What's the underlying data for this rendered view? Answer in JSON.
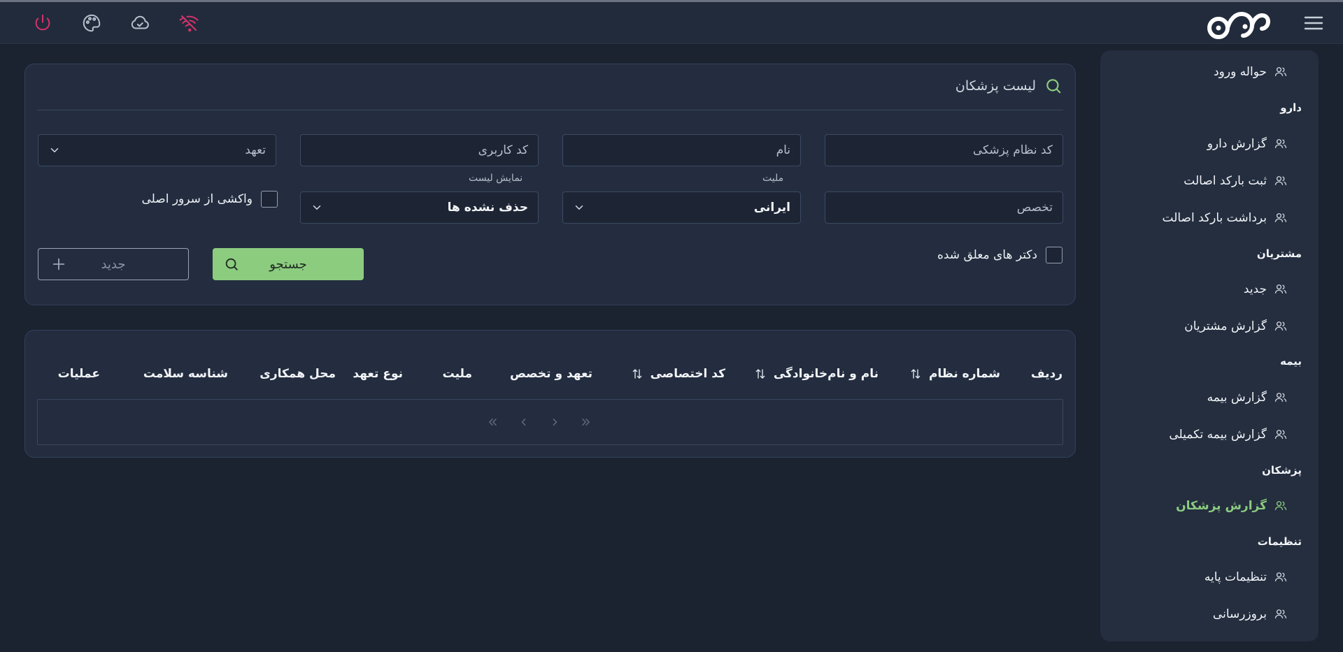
{
  "topbar": {
    "icons": [
      "power-icon",
      "palette-icon",
      "cloud-check-icon",
      "signal-off-icon",
      "logo",
      "hamburger-menu-icon"
    ],
    "colors": {
      "power": "#d6336c",
      "signal_off": "#d6336c",
      "neutral": "#b8c0cc"
    }
  },
  "sidebar": {
    "items": [
      {
        "type": "item",
        "label": "حواله ورود"
      },
      {
        "type": "section",
        "label": "دارو"
      },
      {
        "type": "item",
        "label": "گزارش دارو"
      },
      {
        "type": "item",
        "label": "ثبت بارکد اصالت"
      },
      {
        "type": "item",
        "label": "برداشت بارکد اصالت"
      },
      {
        "type": "section",
        "label": "مشتریان"
      },
      {
        "type": "item",
        "label": "جدید"
      },
      {
        "type": "item",
        "label": "گزارش مشتریان"
      },
      {
        "type": "section",
        "label": "بیمه"
      },
      {
        "type": "item",
        "label": "گزارش بیمه"
      },
      {
        "type": "item",
        "label": "گزارش بیمه تکمیلی"
      },
      {
        "type": "section",
        "label": "پزشکان"
      },
      {
        "type": "item",
        "label": "گزارش پزشکان",
        "active": true
      },
      {
        "type": "section",
        "label": "تنظیمات"
      },
      {
        "type": "item",
        "label": "تنظیمات پایه"
      },
      {
        "type": "item",
        "label": "بروزرسانی"
      }
    ]
  },
  "filter": {
    "title": "لیست پزشکان",
    "medical_code_placeholder": "کد نظام پزشکی",
    "name_placeholder": "نام",
    "user_code_placeholder": "کد کاربری",
    "commitment_placeholder": "تعهد",
    "specialty_placeholder": "تخصص",
    "nationality_label": "ملیت",
    "nationality_value": "ایرانی",
    "list_display_label": "نمایش لیست",
    "list_display_value": "حذف نشده ها",
    "fetch_main_server_label": "واکشی از سرور اصلی",
    "suspended_doctors_label": "دکتر های معلق شده",
    "search_button": "جستجو",
    "new_button": "جدید"
  },
  "table": {
    "columns": [
      "ردیف",
      "شماره نظام",
      "نام و نام‌خانوادگی",
      "کد اختصاصی",
      "تعهد و تخصص",
      "ملیت",
      "نوع تعهد",
      "محل همکاری",
      "شناسه سلامت",
      "عملیات"
    ],
    "sortable_columns": [
      "شماره نظام",
      "نام و نام‌خانوادگی",
      "کد اختصاصی"
    ],
    "rows": [],
    "pagination_icons": [
      "first-page-icon",
      "prev-page-icon",
      "next-page-icon",
      "last-page-icon"
    ]
  },
  "accent_color": "#8ccc7f"
}
